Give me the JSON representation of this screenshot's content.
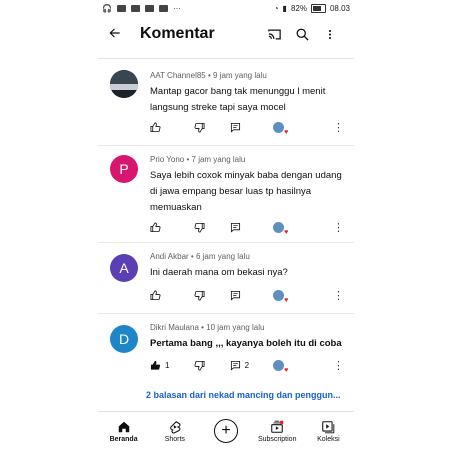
{
  "status_bar": {
    "battery": "82%",
    "time": "08.03"
  },
  "header": {
    "title": "Komentar"
  },
  "comments": [
    {
      "author": "AAT Channel85",
      "time": "9 jam yang lalu",
      "text": "Mantap gacor bang tak menunggu l menit langsung streke tapi saya mocel",
      "avatar_letter": "",
      "avatar_color": "#2b3440",
      "likes": "",
      "replies": ""
    },
    {
      "author": "Prio Yono",
      "time": "7 jam yang lalu",
      "text": "Saya lebih coxok minyak baba dengan udang  di jawa empang besar luas tp hasilnya memuaskan",
      "avatar_letter": "P",
      "avatar_color": "#d6166f",
      "likes": "",
      "replies": ""
    },
    {
      "author": "Andi Akbar",
      "time": "6 jam yang lalu",
      "text": "Ini daerah mana om bekasi nya?",
      "avatar_letter": "A",
      "avatar_color": "#5b3fb5",
      "likes": "",
      "replies": ""
    },
    {
      "author": "Dikri Maulana",
      "time": "10 jam yang lalu",
      "text": "Pertama bang ,,, kayanya boleh itu di coba",
      "avatar_letter": "D",
      "avatar_color": "#1e86c8",
      "likes": "1",
      "replies": "2"
    }
  ],
  "more_replies": "2 balasan dari nekad mancing dan penggun...",
  "bottom_nav": [
    {
      "label": "Beranda",
      "icon": "home-icon"
    },
    {
      "label": "Shorts",
      "icon": "shorts-icon"
    },
    {
      "label": "",
      "icon": "create-icon"
    },
    {
      "label": "Subscription",
      "icon": "subscriptions-icon"
    },
    {
      "label": "Koleksi",
      "icon": "library-icon"
    }
  ]
}
